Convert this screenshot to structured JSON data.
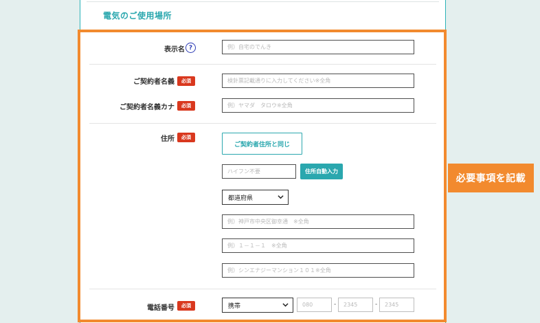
{
  "section": {
    "title": "電気のご使用場所"
  },
  "required_label": "必須",
  "help_glyph": "?",
  "fields": {
    "display_name": {
      "label": "表示名",
      "placeholder": "例）自宅のでんき"
    },
    "contract_name": {
      "label": "ご契約者名義",
      "placeholder": "検針票記載通りに入力してください※全角"
    },
    "contract_kana": {
      "label": "ご契約者名義カナ",
      "placeholder": "例）ヤマダ　タロウ※全角"
    },
    "address": {
      "label": "住所",
      "same_as_contract_button": "ご契約者住所と同じ",
      "zip_placeholder": "ハイフン不要",
      "auto_fill_button": "住所自動入力",
      "prefecture_select": "都道府県",
      "line1_placeholder": "例）神戸市中央区御幸通　※全角",
      "line2_placeholder": "例）１－１－１　※全角",
      "line3_placeholder": "例）シンエナジーマンション１０１※全角"
    },
    "phone": {
      "label": "電話番号",
      "type_select": "携帯",
      "part1_placeholder": "080",
      "part2_placeholder": "2345",
      "part3_placeholder": "2345",
      "separator": "-"
    }
  },
  "callout": {
    "text": "必要事項を記載"
  },
  "colors": {
    "teal": "#2aa7ae",
    "orange": "#f28a2e",
    "required_red": "#d9381e",
    "help_blue": "#2c3bb5",
    "bg": "#e4efee"
  }
}
